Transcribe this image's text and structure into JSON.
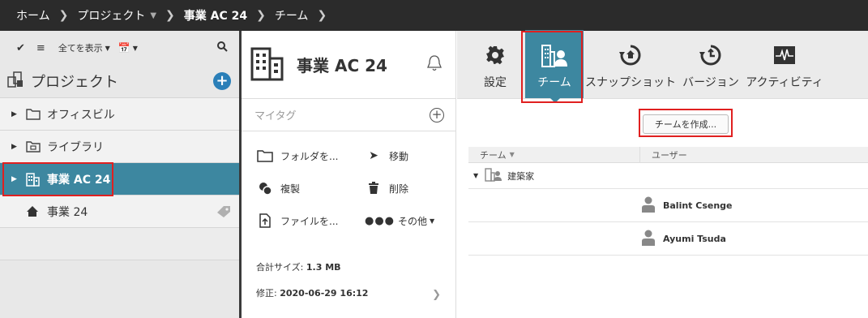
{
  "topbar": {
    "crumbs": [
      "ホーム",
      "プロジェクト",
      "事業 AC 24",
      "チーム"
    ]
  },
  "sidebar": {
    "show_all": "全てを表示",
    "header_title": "プロジェクト",
    "items": [
      {
        "label": "オフィスビル",
        "icon": "folder-icon"
      },
      {
        "label": "ライブラリ",
        "icon": "library-folder-icon"
      },
      {
        "label": "事業 AC 24",
        "icon": "building-icon",
        "active": true
      },
      {
        "label": "事業 24",
        "icon": "house-icon"
      }
    ]
  },
  "middle": {
    "title": "事業 AC 24",
    "mytag_placeholder": "マイタグ",
    "actions": {
      "folder": "フォルダを...",
      "move": "移動",
      "duplicate": "複製",
      "delete": "削除",
      "file": "ファイルを...",
      "more": "その他"
    },
    "total_size_label": "合計サイズ:",
    "total_size_value": "1.3 MB",
    "modified_label": "修正:",
    "modified_value": "2020-06-29 16:12"
  },
  "right": {
    "tabs": {
      "settings": "設定",
      "team": "チーム",
      "snapshot": "スナップショット",
      "version": "バージョン",
      "activity": "アクティビティ"
    },
    "create_team_button": "チームを作成...",
    "table": {
      "col_team": "チーム",
      "col_user": "ユーザー",
      "group": "建築家",
      "users": [
        "Balint Csenge",
        "Ayumi Tsuda"
      ]
    }
  },
  "colors": {
    "accent": "#3d87a0",
    "add_button": "#2a7fb8",
    "highlight": "#e02020",
    "topbar": "#2b2b2b"
  }
}
